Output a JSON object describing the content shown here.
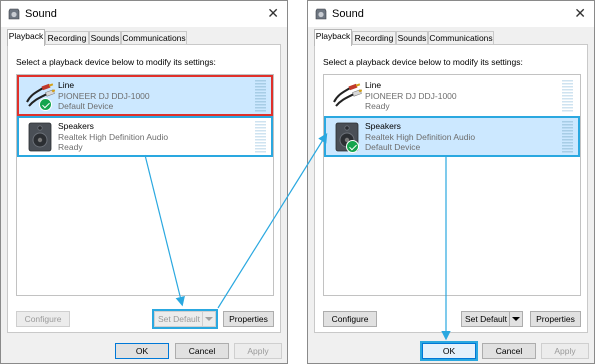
{
  "left_dialog": {
    "title": "Sound",
    "close_symbol": "✕",
    "tabs": [
      {
        "label": "Playback",
        "active": true
      },
      {
        "label": "Recording",
        "active": false
      },
      {
        "label": "Sounds",
        "active": false
      },
      {
        "label": "Communications",
        "active": false
      }
    ],
    "instruction": "Select a playback device below to modify its settings:",
    "devices": [
      {
        "name": "Line",
        "description": "PIONEER DJ DDJ-1000",
        "status": "Default Device",
        "icon": "rca-cable-icon",
        "selected": true,
        "is_default": true
      },
      {
        "name": "Speakers",
        "description": "Realtek High Definition Audio",
        "status": "Ready",
        "icon": "speaker-icon",
        "selected": false,
        "is_default": false
      }
    ],
    "buttons": {
      "configure": "Configure",
      "set_default": "Set Default",
      "properties": "Properties",
      "ok": "OK",
      "cancel": "Cancel",
      "apply": "Apply"
    }
  },
  "right_dialog": {
    "title": "Sound",
    "close_symbol": "✕",
    "tabs": [
      {
        "label": "Playback",
        "active": true
      },
      {
        "label": "Recording",
        "active": false
      },
      {
        "label": "Sounds",
        "active": false
      },
      {
        "label": "Communications",
        "active": false
      }
    ],
    "instruction": "Select a playback device below to modify its settings:",
    "devices": [
      {
        "name": "Line",
        "description": "PIONEER DJ DDJ-1000",
        "status": "Ready",
        "icon": "rca-cable-icon",
        "selected": false,
        "is_default": false
      },
      {
        "name": "Speakers",
        "description": "Realtek High Definition Audio",
        "status": "Default Device",
        "icon": "speaker-icon",
        "selected": true,
        "is_default": true
      }
    ],
    "buttons": {
      "configure": "Configure",
      "set_default": "Set Default",
      "properties": "Properties",
      "ok": "OK",
      "cancel": "Cancel",
      "apply": "Apply"
    }
  },
  "colors": {
    "selection": "#cce8ff",
    "highlight_red": "#e0302a",
    "highlight_blue": "#2aa8e0",
    "default_check": "#14a44d"
  }
}
